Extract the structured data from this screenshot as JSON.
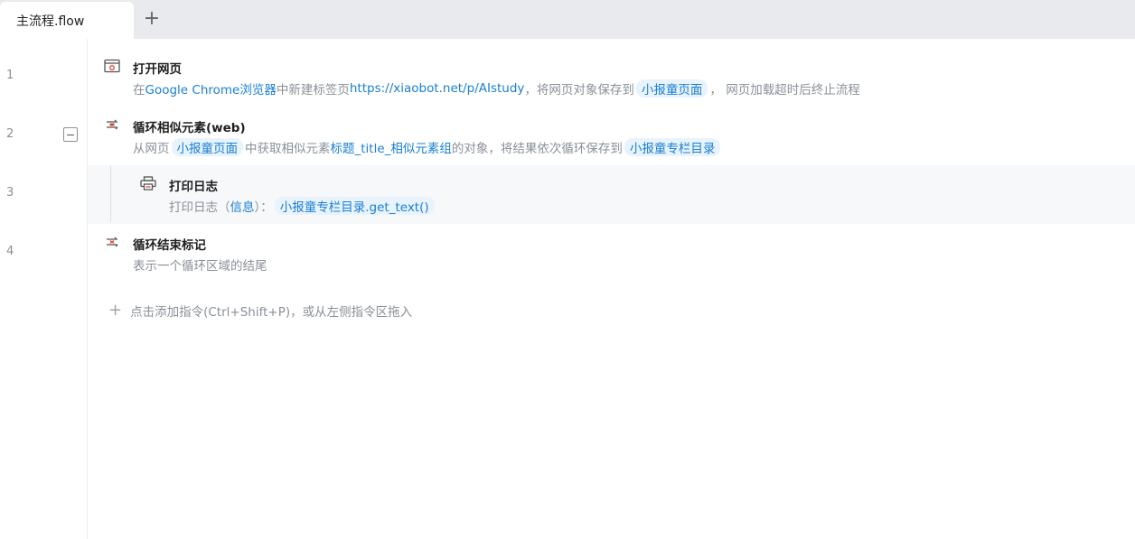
{
  "tabs": [
    {
      "label": "主流程.flow"
    }
  ],
  "line_numbers": [
    "1",
    "2",
    "3",
    "4"
  ],
  "steps": [
    {
      "title": "打开网页",
      "desc": {
        "p1": "在",
        "browser": "Google Chrome浏览器",
        "p2": "中新建标签页",
        "url": "https://xiaobot.net/p/AIstudy",
        "p3": "，将网页对象保存到",
        "var": "小报童页面",
        "p4": "， 网页加载超时后终止流程"
      }
    },
    {
      "title": "循环相似元素(web)",
      "desc": {
        "p1": "从网页",
        "var1": "小报童页面",
        "p2": "中获取相似元素",
        "elem": "标题_title_相似元素组",
        "p3": "的对象，将结果依次循环保存到",
        "var2": "小报童专栏目录"
      }
    },
    {
      "title": "打印日志",
      "desc": {
        "p1": "打印日志（",
        "level": "信息",
        "p2": "）：",
        "expr": "小报童专栏目录.get_text()"
      }
    },
    {
      "title": "循环结束标记",
      "desc": {
        "p1": "表示一个循环区域的结尾"
      }
    }
  ],
  "add_hint": "点击添加指令(Ctrl+Shift+P)，或从左侧指令区拖入",
  "colors": {
    "link": "#1a7fd0",
    "muted": "#8a8f99",
    "nested_bg": "#f7f8fa",
    "tabbar": "#e9eaed"
  },
  "icons": [
    "browser-window-icon",
    "loop-icon",
    "printer-icon",
    "loop-end-icon",
    "collapse-icon",
    "plus-icon"
  ]
}
